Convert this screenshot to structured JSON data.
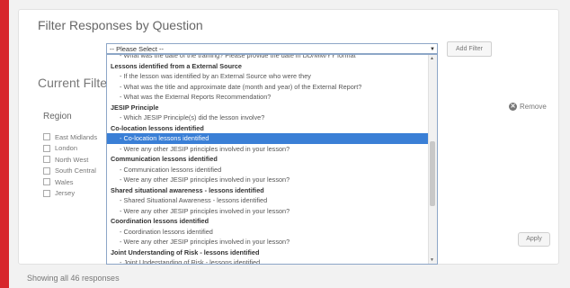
{
  "filter_title": "Filter Responses by Question",
  "select_value": "-- Please Select --",
  "add_filter_label": "Add Filter",
  "current_title": "Current Filte",
  "region_label": "Region",
  "regions": [
    "East Midlands",
    "London",
    "North West",
    "South Central",
    "Wales",
    "Jersey"
  ],
  "remove_label": "Remove",
  "apply_label": "Apply",
  "showing_text": "Showing all 46 responses",
  "options": [
    {
      "type": "opt",
      "text": "- What was the date of the training? Please provide the date in DD/MM/YY format"
    },
    {
      "type": "group",
      "text": "Lessons identified from a External Source"
    },
    {
      "type": "opt",
      "text": "- If the lesson was identified by an External Source who were they"
    },
    {
      "type": "opt",
      "text": "- What was the title and approximate date (month and year) of the External Report?"
    },
    {
      "type": "opt",
      "text": "- What was the External Reports Recommendation?"
    },
    {
      "type": "group",
      "text": "JESIP Principle"
    },
    {
      "type": "opt",
      "text": "- Which JESIP Principle(s) did the lesson involve?"
    },
    {
      "type": "group",
      "text": "Co-location lessons identified"
    },
    {
      "type": "sel",
      "text": "- Co-location lessons identified"
    },
    {
      "type": "opt",
      "text": "- Were any other JESIP principles involved in your lesson?"
    },
    {
      "type": "group",
      "text": "Communication lessons identified"
    },
    {
      "type": "opt",
      "text": "- Communication lessons identified"
    },
    {
      "type": "opt",
      "text": "- Were any other JESIP principles involved in your lesson?"
    },
    {
      "type": "group",
      "text": "Shared situational awareness - lessons identified"
    },
    {
      "type": "opt",
      "text": "- Shared Situational Awareness - lessons identified"
    },
    {
      "type": "opt",
      "text": "- Were any other JESIP principles involved in your lesson?"
    },
    {
      "type": "group",
      "text": "Coordination lessons identified"
    },
    {
      "type": "opt",
      "text": "- Coordination lessons identified"
    },
    {
      "type": "opt",
      "text": "- Were any other JESIP principles involved in your lesson?"
    },
    {
      "type": "group",
      "text": "Joint Understanding of Risk - lessons identified"
    },
    {
      "type": "opt",
      "text": "- Joint Understanding of Risk - lessons identified"
    }
  ]
}
